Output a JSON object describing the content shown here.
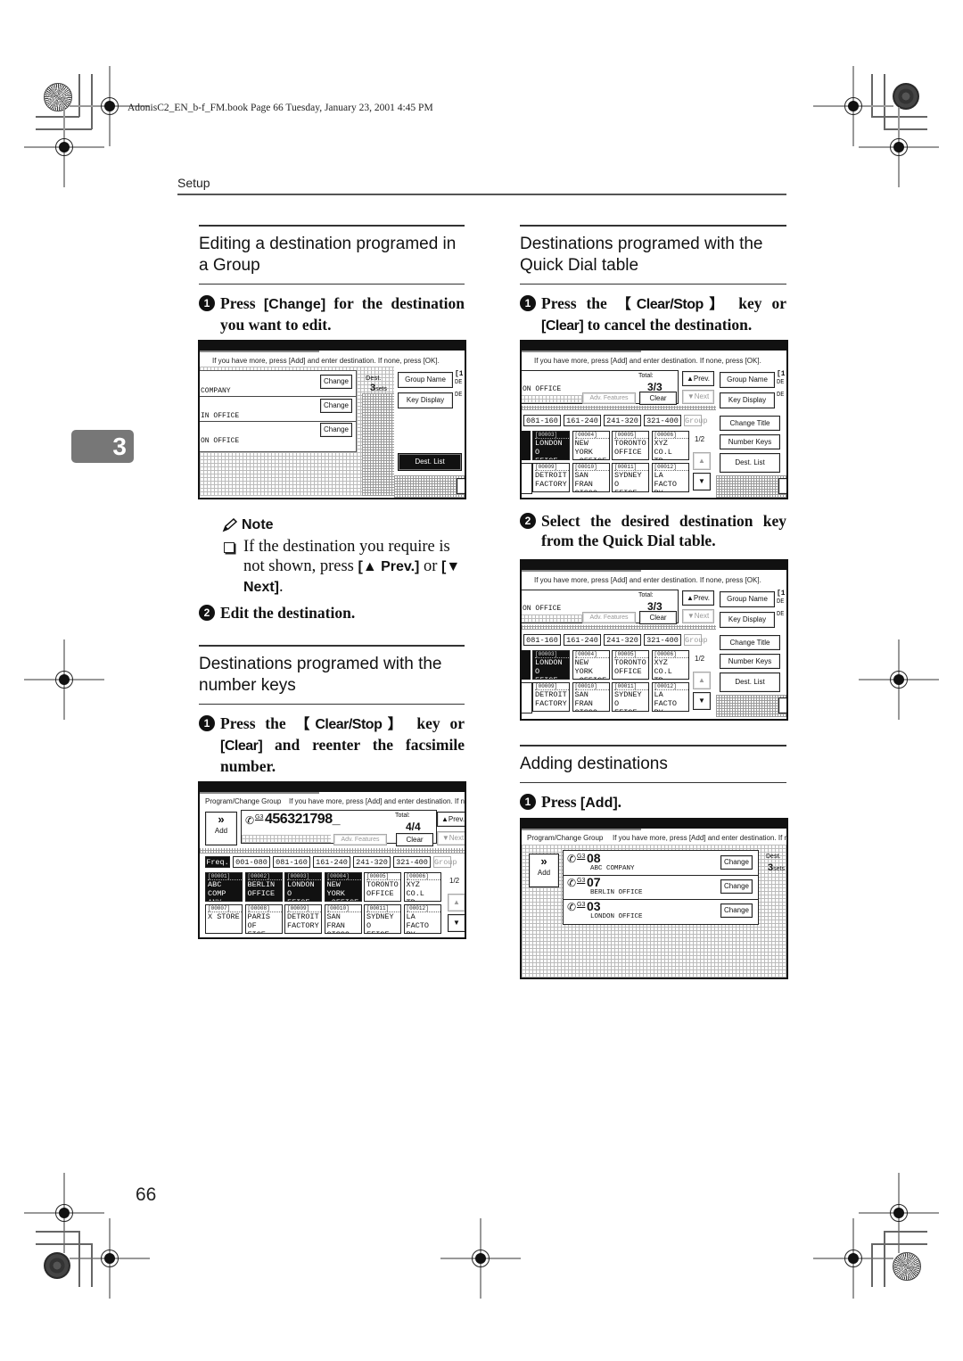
{
  "file_meta": "AdonisC2_EN_b-f_FM.book  Page 66  Tuesday, January 23, 2001  4:45 PM",
  "running_head": "Setup",
  "chapter_tab": "3",
  "page_number": "66",
  "left_column": {
    "section1": {
      "title": "Editing a destination programed in a Group",
      "step1": {
        "num": "1",
        "pre": "Press ",
        "key": "[Change]",
        "post": " for the destination you want to edit."
      },
      "screen": {
        "message": "If you have more, press [Add] and enter destination. If none, press [OK].",
        "entries": [
          "COMPANY",
          "IN OFFICE",
          "ON OFFICE"
        ],
        "change_label": "Change",
        "dest_label": "Dest.",
        "dest_count": "3",
        "dest_unit": "sets",
        "group_name": "Group Name",
        "key_display": "Key Display",
        "dest_list": "Dest. List",
        "edge_labels": [
          "[1",
          "DE",
          "DE"
        ]
      },
      "note": {
        "title": "Note",
        "text_pre": "If the destination you require is not shown, press ",
        "prev_key": "[▲ Prev.]",
        "mid": " or ",
        "next_key": "[▼ Next]",
        "end": "."
      },
      "step2": {
        "num": "2",
        "text": "Edit the destination."
      }
    },
    "section2": {
      "title": "Destinations programed with the number keys",
      "step1": {
        "num": "1",
        "pre": "Press the ",
        "key1": "【Clear/Stop】",
        "mid": " key or ",
        "key2": "[Clear]",
        "post": " and reenter the facsimile number."
      },
      "screen": {
        "header": "Program/Change Group",
        "message": "If you have more, press [Add] and enter destination. If none, p",
        "add_label": "Add",
        "add_arrows": "»",
        "line": "G3",
        "number": "456321798_",
        "total_label": "Total:",
        "total_value": "4/4",
        "adv_features": "Adv. Features",
        "clear": "Clear",
        "prev": "▲Prev.",
        "next": "▼Next",
        "tabs": [
          "Freq.",
          "001-080",
          "081-160",
          "161-240",
          "241-320",
          "321-400",
          "Group"
        ],
        "keys_row1": [
          {
            "code": "[00001]",
            "l1": "ABC COMP",
            "l2": "ANY",
            "dark": true
          },
          {
            "code": "[00002]",
            "l1": "BERLIN",
            "l2": "OFFICE",
            "dark": true
          },
          {
            "code": "[00003]",
            "l1": "LONDON O",
            "l2": "FFICE",
            "dark": true
          },
          {
            "code": "[00004]",
            "l1": "NEW YORK",
            "l2": " OFFICE",
            "dark": true
          },
          {
            "code": "[00005]",
            "l1": "TORONTO",
            "l2": "OFFICE",
            "dark": false
          },
          {
            "code": "[00006]",
            "l1": "XYZ CO.L",
            "l2": "TD",
            "dark": false
          }
        ],
        "keys_row2": [
          {
            "code": "[00007]",
            "l1": "X STORE",
            "l2": ""
          },
          {
            "code": "[00008]",
            "l1": "PARIS OF",
            "l2": "FICE"
          },
          {
            "code": "[00009]",
            "l1": "DETROIT",
            "l2": "FACTORY"
          },
          {
            "code": "[00010]",
            "l1": "SAN FRAN",
            "l2": "CISCO"
          },
          {
            "code": "[00011]",
            "l1": "SYDNEY O",
            "l2": "FFICE"
          },
          {
            "code": "[00012]",
            "l1": "LA FACTO",
            "l2": "RY"
          }
        ],
        "page_indicator": "1/2"
      }
    }
  },
  "right_column": {
    "section1": {
      "title": "Destinations programed with the Quick Dial table",
      "step1": {
        "num": "1",
        "pre": "Press the ",
        "key1": "【Clear/Stop】",
        "mid": " key or ",
        "key2": "[Clear]",
        "post": " to cancel the destination."
      },
      "step2": {
        "num": "2",
        "text": "Select the desired destination key from the Quick Dial table."
      },
      "screen": {
        "message": "If you have more, press [Add] and enter destination. If none, press [OK].",
        "entry": "ON OFFICE",
        "total_label": "Total:",
        "total_value": "3/3",
        "adv_features": "Adv. Features",
        "clear": "Clear",
        "prev": "▲Prev.",
        "next": "▼Next",
        "group_name": "Group Name",
        "key_display": "Key Display",
        "change_title": "Change Title",
        "number_keys": "Number Keys",
        "dest_list": "Dest. List",
        "edge_labels": [
          "[1",
          "DE",
          "DE"
        ],
        "tabs": [
          "081-160",
          "161-240",
          "241-320",
          "321-400",
          "Group"
        ],
        "keys_row1": [
          {
            "code": "[00003]",
            "l1": "LONDON O",
            "l2": "FFICE",
            "dark": true
          },
          {
            "code": "[00004]",
            "l1": "NEW YORK",
            "l2": " OFFICE",
            "dark": false
          },
          {
            "code": "[00005]",
            "l1": "TORONTO",
            "l2": "OFFICE",
            "dark": false
          },
          {
            "code": "[00006]",
            "l1": "XYZ CO.L",
            "l2": "TD",
            "dark": false
          }
        ],
        "keys_row2": [
          {
            "code": "[00009]",
            "l1": "DETROIT",
            "l2": "FACTORY"
          },
          {
            "code": "[00010]",
            "l1": "SAN FRAN",
            "l2": "CISCO"
          },
          {
            "code": "[00011]",
            "l1": "SYDNEY O",
            "l2": "FFICE"
          },
          {
            "code": "[00012]",
            "l1": "LA FACTO",
            "l2": "RY"
          }
        ],
        "page_indicator": "1/2"
      }
    },
    "section2": {
      "title": "Adding destinations",
      "step1": {
        "num": "1",
        "pre": "Press ",
        "key": "[Add]",
        "post": "."
      },
      "screen": {
        "header": "Program/Change Group",
        "message": "If you have more, press [Add] and enter destination. If none, p",
        "add_label": "Add",
        "add_arrows": "»",
        "entries": [
          {
            "line": "G3",
            "num": "08",
            "name": "ABC COMPANY"
          },
          {
            "line": "G3",
            "num": "07",
            "name": "BERLIN OFFICE"
          },
          {
            "line": "G3",
            "num": "03",
            "name": "LONDON OFFICE"
          }
        ],
        "change_label": "Change",
        "dest_label": "Dest.",
        "dest_count": "3",
        "dest_unit": "sets"
      }
    }
  }
}
